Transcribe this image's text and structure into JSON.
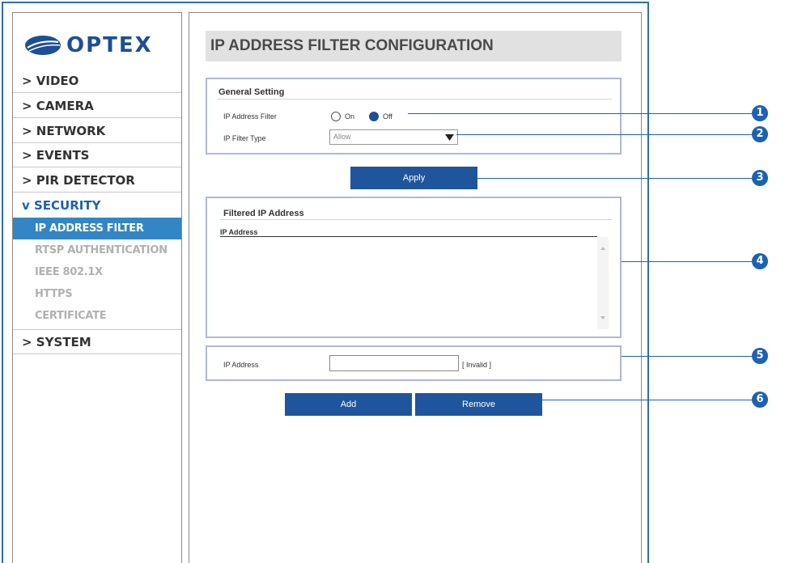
{
  "brand": {
    "name": "OPTEX",
    "color": "#1d4e97"
  },
  "sidebar": {
    "items": [
      {
        "label": "> VIDEO"
      },
      {
        "label": "> CAMERA"
      },
      {
        "label": "> NETWORK"
      },
      {
        "label": "> EVENTS"
      },
      {
        "label": "> PIR DETECTOR"
      },
      {
        "label": "v SECURITY"
      },
      {
        "label": "> SYSTEM"
      }
    ],
    "security_sub": [
      {
        "label": "IP ADDRESS FILTER"
      },
      {
        "label": "RTSP AUTHENTICATION"
      },
      {
        "label": "IEEE 802.1X"
      },
      {
        "label": "HTTPS"
      },
      {
        "label": "CERTIFICATE"
      }
    ]
  },
  "page": {
    "title": "IP ADDRESS FILTER CONFIGURATION"
  },
  "general": {
    "section_title": "General Setting",
    "filter_label": "IP Address Filter",
    "on_label": "On",
    "off_label": "Off",
    "selected": "Off",
    "type_label": "IP Filter Type",
    "type_value": "Allow"
  },
  "apply_label": "Apply",
  "filtered": {
    "section_title": "Filtered IP Address",
    "column_header": "IP Address"
  },
  "add_ip": {
    "label": "IP Address",
    "value": "",
    "status": "[ Invalid ]"
  },
  "add_label": "Add",
  "remove_label": "Remove",
  "callouts": [
    "1",
    "2",
    "3",
    "4",
    "5",
    "6"
  ],
  "colors": {
    "accent": "#1c62b0",
    "button": "#1f559c",
    "selected_bg": "#3286c4",
    "frame": "#2d6db3"
  }
}
